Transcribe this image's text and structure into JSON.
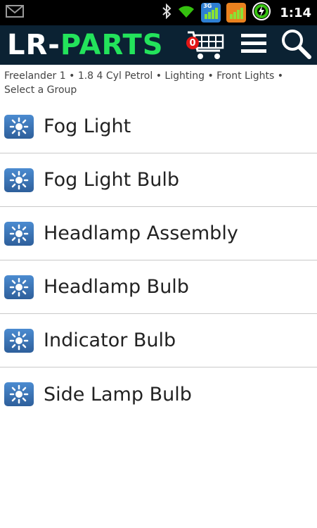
{
  "status_bar": {
    "time": "1:14",
    "network_label": "3G",
    "icons": [
      "gmail-icon",
      "bluetooth-icon",
      "wifi-icon",
      "signal-3g-icon",
      "signal-icon",
      "battery-charging-icon"
    ]
  },
  "header": {
    "logo_lr": "LR-",
    "logo_parts": "PARTS",
    "cart_count": "0",
    "icons": [
      "cart-icon",
      "menu-icon",
      "search-icon"
    ]
  },
  "breadcrumb": {
    "text": "Freelander 1 • 1.8 4 Cyl Petrol • Lighting • Front Lights • Select a Group"
  },
  "groups": [
    {
      "label": "Fog Light",
      "icon": "light-icon"
    },
    {
      "label": "Fog Light Bulb",
      "icon": "light-icon"
    },
    {
      "label": "Headlamp Assembly",
      "icon": "light-icon"
    },
    {
      "label": "Headlamp Bulb",
      "icon": "light-icon"
    },
    {
      "label": "Indicator Bulb",
      "icon": "light-icon"
    },
    {
      "label": "Side Lamp Bulb",
      "icon": "light-icon"
    }
  ],
  "colors": {
    "header_bg": "#0b2233",
    "logo_green": "#23e35b",
    "badge_red": "#e31616",
    "icon_blue": "#3a74b6"
  }
}
